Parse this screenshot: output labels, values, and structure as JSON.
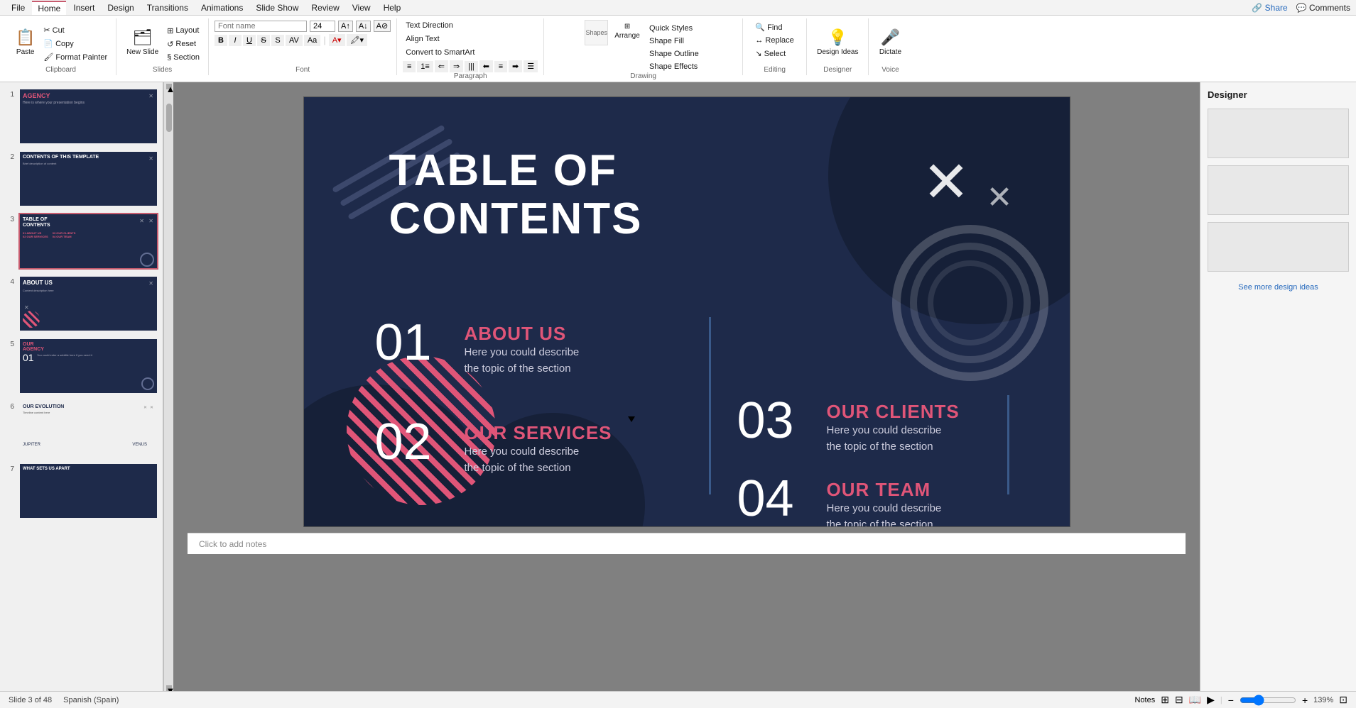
{
  "app": {
    "title": "PowerPoint"
  },
  "menubar": {
    "items": [
      "File",
      "Home",
      "Insert",
      "Design",
      "Transitions",
      "Animations",
      "Slide Show",
      "Review",
      "View",
      "Help"
    ],
    "active": "Home",
    "share_label": "Share",
    "comments_label": "Comments"
  },
  "ribbon": {
    "clipboard_group": "Clipboard",
    "slides_group": "Slides",
    "font_group": "Font",
    "paragraph_group": "Paragraph",
    "drawing_group": "Drawing",
    "editing_group": "Editing",
    "designer_group": "Designer",
    "voice_group": "Voice",
    "paste_label": "Paste",
    "new_slide_label": "New Slide",
    "layout_label": "Layout",
    "reset_label": "Reset",
    "section_label": "Section",
    "font_name": "",
    "font_size": "24",
    "bold_label": "B",
    "italic_label": "I",
    "underline_label": "U",
    "cut_label": "Cut",
    "copy_label": "Copy",
    "format_painter_label": "Format Painter",
    "text_direction_label": "Text Direction",
    "align_text_label": "Align Text",
    "convert_smartart_label": "Convert to SmartArt",
    "arrange_label": "Arrange",
    "quick_styles_label": "Quick Styles",
    "shape_fill_label": "Shape Fill",
    "shape_outline_label": "Shape Outline",
    "shape_effects_label": "Shape Effects",
    "find_label": "Find",
    "replace_label": "Replace",
    "select_label": "Select",
    "design_ideas_label": "Design Ideas",
    "dictate_label": "Dictate"
  },
  "slides": [
    {
      "number": 1,
      "title": "AGENCY",
      "subtitle": "Here is where your presentation begins",
      "bg": "#1e2a4a",
      "active": false
    },
    {
      "number": 2,
      "title": "CONTENTS OF THIS TEMPLATE",
      "bg": "#1e2a4a",
      "active": false
    },
    {
      "number": 3,
      "title": "TABLE OF CONTENTS",
      "bg": "#1e2a4a",
      "active": true
    },
    {
      "number": 4,
      "title": "ABOUT US",
      "bg": "#1e2a4a",
      "active": false
    },
    {
      "number": 5,
      "title": "OUR AGENCY",
      "number_display": "01",
      "bg": "#1e2a4a",
      "active": false
    },
    {
      "number": 6,
      "title": "OUR EVOLUTION",
      "bg": "#f5f5f5",
      "active": false
    },
    {
      "number": 7,
      "title": "WHAT SETS US APART",
      "bg": "#1e2a4a",
      "active": false
    }
  ],
  "main_slide": {
    "title_line1": "TABLE OF",
    "title_line2": "CONTENTS",
    "items": [
      {
        "number": "01",
        "heading": "ABOUT US",
        "description_line1": "Here you could describe",
        "description_line2": "the topic of the section",
        "color": "#e05578"
      },
      {
        "number": "02",
        "heading": "OUR SERVICES",
        "description_line1": "Here you could describe",
        "description_line2": "the topic of the section",
        "color": "#e05578"
      },
      {
        "number": "03",
        "heading": "OUR CLIENTS",
        "description_line1": "Here you could describe",
        "description_line2": "the topic of the section",
        "color": "#e05578"
      },
      {
        "number": "04",
        "heading": "OUR TEAM",
        "description_line1": "Here you could describe",
        "description_line2": "the topic of the section",
        "color": "#e05578"
      }
    ]
  },
  "status_bar": {
    "slide_info": "Slide 3 of 48",
    "language": "Spanish (Spain)",
    "notes_label": "Notes",
    "zoom_level": "139%",
    "click_to_add_notes": "Click to add notes"
  }
}
